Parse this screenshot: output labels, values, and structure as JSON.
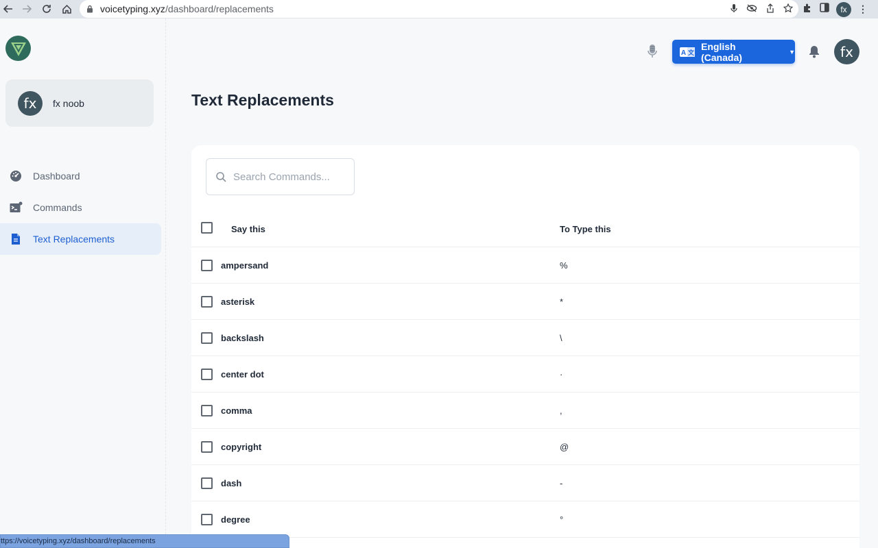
{
  "browser": {
    "url_host": "voicetyping.xyz",
    "url_path": "/dashboard/replacements",
    "profile_initials": "fx"
  },
  "sidebar": {
    "user_initials": "fx",
    "user_name": "fx noob",
    "items": [
      {
        "label": "Dashboard",
        "icon": "dashboard-gauge-icon"
      },
      {
        "label": "Commands",
        "icon": "terminal-icon"
      },
      {
        "label": "Text Replacements",
        "icon": "document-icon",
        "active": true
      }
    ]
  },
  "header": {
    "language_label": "English (Canada)",
    "avatar_initials": "fx"
  },
  "page": {
    "title": "Text Replacements"
  },
  "search": {
    "placeholder": "Search Commands..."
  },
  "table": {
    "columns": [
      "Say this",
      "To Type this"
    ],
    "rows": [
      {
        "say": "ampersand",
        "type": "%"
      },
      {
        "say": "asterisk",
        "type": "*"
      },
      {
        "say": "backslash",
        "type": "\\"
      },
      {
        "say": "center dot",
        "type": "·"
      },
      {
        "say": "comma",
        "type": ","
      },
      {
        "say": "copyright",
        "type": "@"
      },
      {
        "say": "dash",
        "type": "-"
      },
      {
        "say": "degree",
        "type": "°"
      }
    ]
  },
  "status_bar": {
    "text": "ttps://voicetyping.xyz/dashboard/replacements"
  },
  "colors": {
    "accent": "#1c66dd",
    "active_nav_bg": "#e6eef9",
    "avatar": "#3f5560"
  }
}
